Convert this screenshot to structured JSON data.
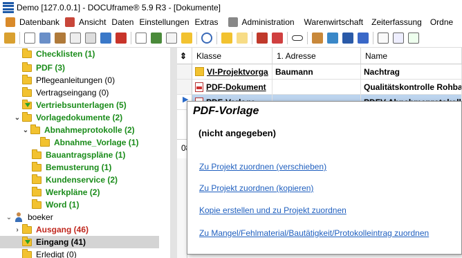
{
  "window": {
    "title": "Demo [127.0.0.1] - DOCUframe® 5.9 R3 - [Dokumente]"
  },
  "menu": [
    "Datenbank",
    "Ansicht",
    "Daten",
    "Einstellungen",
    "Extras",
    "Administration",
    "Warenwirtschaft",
    "Zeiterfassung",
    "Ordne"
  ],
  "tree": [
    {
      "label": "Checklisten (1)",
      "style": "green"
    },
    {
      "label": "PDF (3)",
      "style": "green"
    },
    {
      "label": "Pflegeanleitungen (0)",
      "style": "normal"
    },
    {
      "label": "Vertragseingang (0)",
      "style": "normal"
    },
    {
      "label": "Vertriebsunterlagen (5)",
      "style": "green"
    },
    {
      "label": "Vorlagedokumente (2)",
      "style": "green"
    },
    {
      "label": "Abnahmeprotokolle (2)",
      "style": "green"
    },
    {
      "label": "Abnahme_Vorlage (1)",
      "style": "green"
    },
    {
      "label": "Bauantragspläne (1)",
      "style": "green"
    },
    {
      "label": "Bemusterung (1)",
      "style": "green"
    },
    {
      "label": "Kundenservice (2)",
      "style": "green"
    },
    {
      "label": "Werkpläne (2)",
      "style": "green"
    },
    {
      "label": "Word (1)",
      "style": "green"
    },
    {
      "label": "boeker",
      "style": "normal"
    },
    {
      "label": "Ausgang (46)",
      "style": "red"
    },
    {
      "label": "Eingang (41)",
      "style": "bold"
    },
    {
      "label": "Erledigt (0)",
      "style": "normal"
    }
  ],
  "grid": {
    "sort_glyph": "⇕",
    "columns": [
      "Klasse",
      "1. Adresse",
      "Name"
    ],
    "rows": [
      {
        "klasse": "VI-Projektvorga",
        "adresse": "Baumann",
        "name": "Nachtrag"
      },
      {
        "klasse": "PDF-Dokument",
        "adresse": "",
        "name": "Qualitätskontrolle Rohbau"
      },
      {
        "klasse": "PDF-Vorlage",
        "adresse": "",
        "name": "PDFV Abnahmeprotokoll"
      }
    ],
    "partial_left": "08"
  },
  "popup": {
    "title": "PDF-Vorlage",
    "description": "(nicht angegeben)",
    "links": [
      "Zu Projekt zuordnen (verschieben)",
      "Zu Projekt zuordnen (kopieren)",
      "Kopie erstellen und zu Projekt zuordnen",
      "Zu Mangel/Fehlmaterial/Bautätigkeit/Protokolleintrag zuordnen"
    ]
  },
  "colors": {
    "green_text": "#1a8c1a",
    "red_text": "#c0281e",
    "link": "#1f5fbf",
    "folder": "#f2c230"
  }
}
